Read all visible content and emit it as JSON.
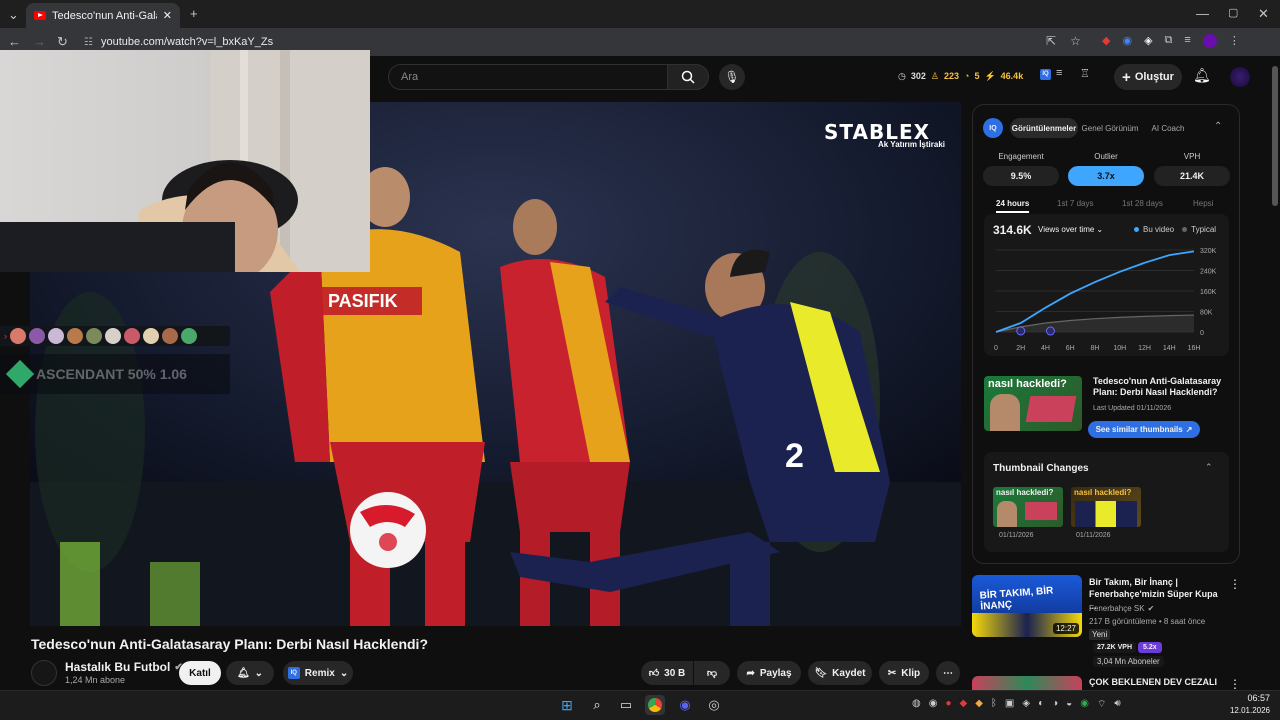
{
  "browser": {
    "tab_title": "Tedesco'nun Anti-Galatasaray P",
    "url": "youtube.com/watch?v=l_bxKaY_Zs"
  },
  "youtube": {
    "search_placeholder": "Ara",
    "stats": {
      "a": "302",
      "b": "223",
      "c": "5",
      "d": "46.4k"
    },
    "create_label": "Oluştur"
  },
  "video": {
    "brand": "STABLEX",
    "brand_sub": "Ak Yatırım İştiraki",
    "overlay_text": "ASCENDANT 50% 1.06",
    "title": "Tedesco'nun Anti-Galatasaray Planı: Derbi Nasıl Hacklendi?",
    "channel": "Hastalık Bu Futbol",
    "subs": "1,24 Mn abone",
    "join": "Katıl",
    "remix": "Remix",
    "likes": "30 B",
    "share": "Paylaş",
    "save": "Kaydet",
    "clip": "Klip"
  },
  "panel": {
    "tabs": [
      "Görüntülenmeler",
      "Genel Görünüm",
      "AI Coach"
    ],
    "metrics": [
      {
        "label": "Engagement",
        "value": "9.5%"
      },
      {
        "label": "Outlier",
        "value": "3.7x"
      },
      {
        "label": "VPH",
        "value": "21.4K"
      }
    ],
    "periods": [
      "24 hours",
      "1st 7 days",
      "1st 28 days",
      "Hepsi"
    ],
    "views_total": "314.6K",
    "views_mode": "Views over time",
    "legend_this": "Bu video",
    "legend_typical": "Typical",
    "similar_title": "Tedesco'nun Anti-Galatasaray Planı: Derbi Nasıl Hacklendi?",
    "last_updated": "Last Updated 01/11/2026",
    "similar_button": "See similar thumbnails",
    "thumb_changes_title": "Thumbnail Changes",
    "thumb_dates": [
      "01/11/2026",
      "01/11/2026"
    ],
    "thumb_text": "nasıl hackledi?"
  },
  "chart_data": {
    "type": "line",
    "x": [
      "0",
      "2H",
      "4H",
      "6H",
      "8H",
      "10H",
      "12H",
      "14H",
      "16H"
    ],
    "series": [
      {
        "name": "Bu video",
        "values": [
          0,
          35,
          95,
          150,
          195,
          235,
          270,
          300,
          314.6
        ]
      },
      {
        "name": "Typical",
        "values": [
          0,
          20,
          35,
          45,
          52,
          57,
          61,
          64,
          66
        ]
      }
    ],
    "yticks": [
      "0",
      "80K",
      "160K",
      "240K",
      "320K"
    ],
    "ylim": [
      0,
      320
    ]
  },
  "recommendations": [
    {
      "title": "Bir Takım, Bir İnanç | Fenerbahçe'mizin Süper Kupa ...",
      "channel": "Fenerbahçe SK",
      "meta": "217 B görüntüleme • 8 saat önce",
      "badge": "Yeni",
      "vph": "27.2K VPH",
      "mult": "5.2x",
      "subs": "3,04 Mn Aboneler",
      "duration": "12:27",
      "thumb_text": "BİR TAKIM, BİR İNANÇ"
    },
    {
      "title": "ÇOK BEKLENEN DEV CEZALI"
    }
  ],
  "taskbar": {
    "time": "06:57",
    "date": "12.01.2026"
  }
}
